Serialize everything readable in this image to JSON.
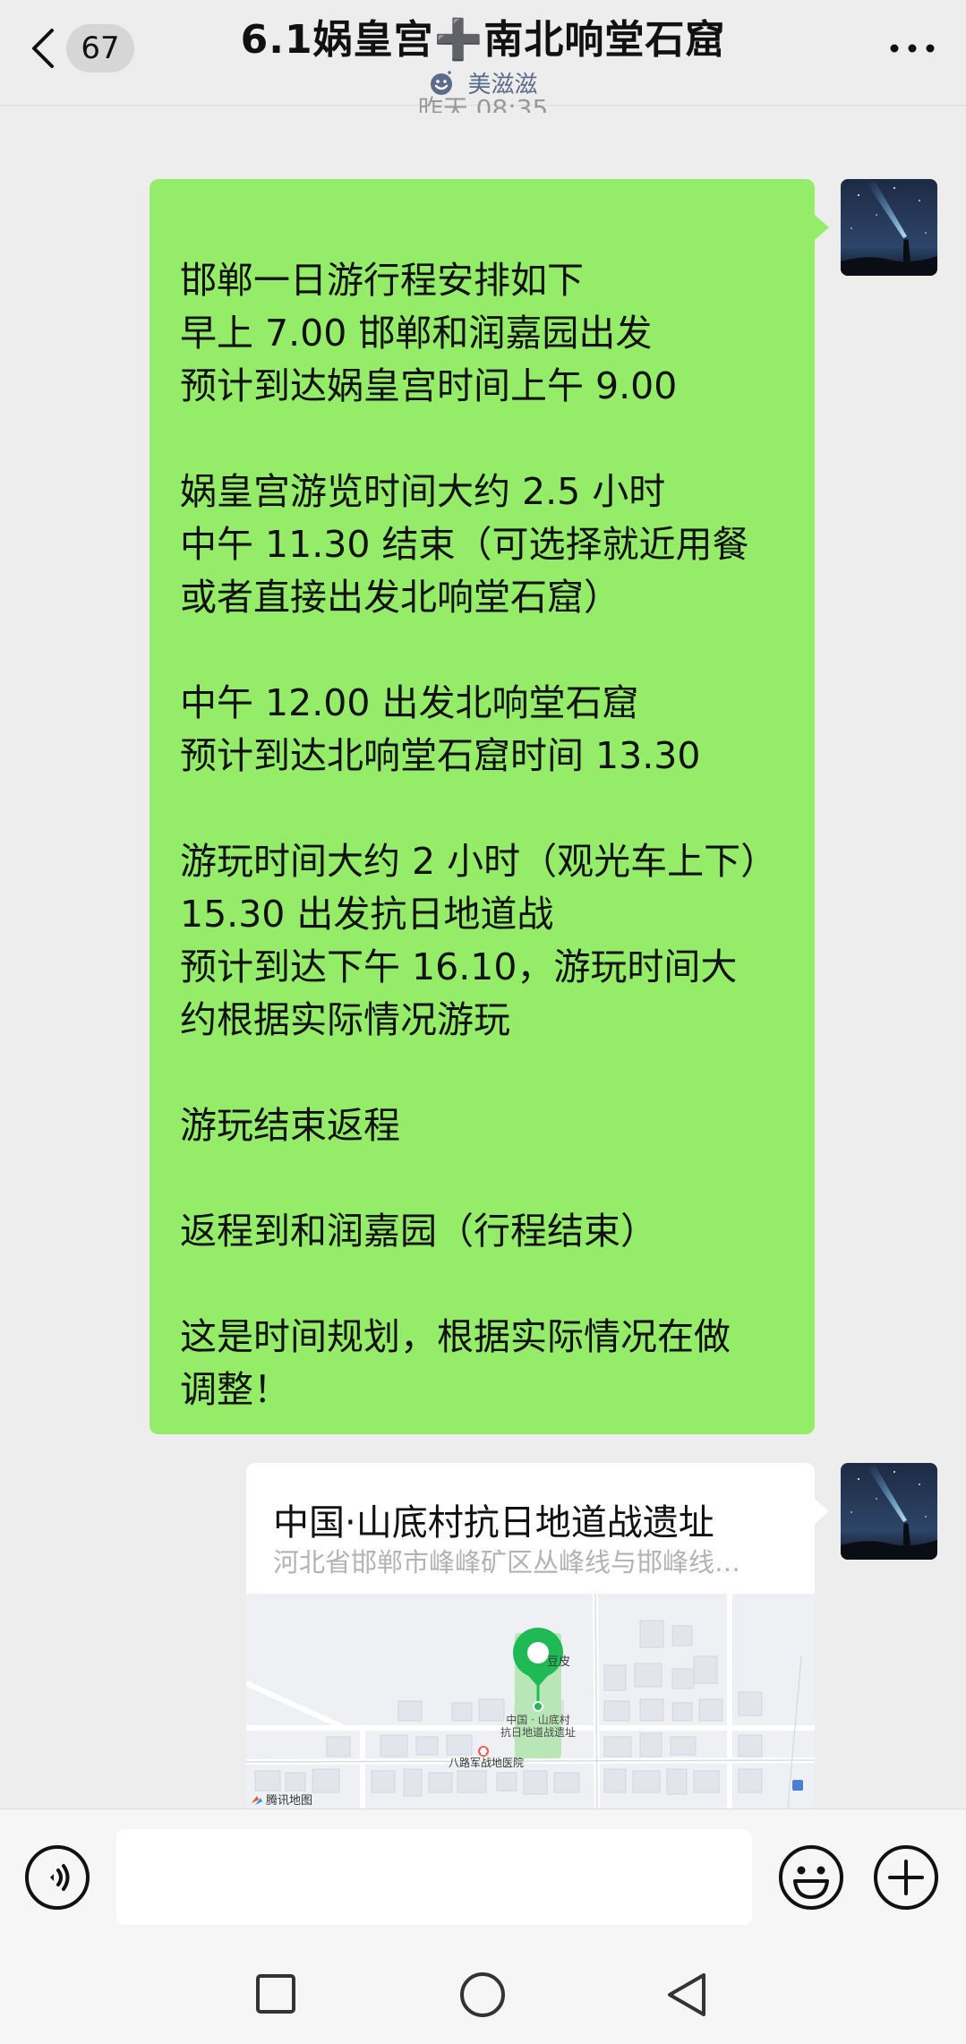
{
  "header": {
    "back_icon": "chevron-left-icon",
    "unread_count": "67",
    "title": "6.1娲皇宫➕南北响堂石窟",
    "subtitle": "美滋滋",
    "more_icon": "more-dots-icon"
  },
  "timestamp": "昨天 08:35",
  "messages": {
    "text_message": {
      "lines": [
        "邯郸一日游行程安排如下",
        "早上 7.00 邯郸和润嘉园出发",
        "预计到达娲皇宫时间上午 9.00",
        "",
        "娲皇宫游览时间大约 2.5 小时",
        "中午 11.30 结束（可选择就近用餐",
        "或者直接出发北响堂石窟）",
        "",
        "中午 12.00 出发北响堂石窟",
        "预计到达北响堂石窟时间 13.30",
        "",
        "游玩时间大约 2 小时（观光车上下）",
        "15.30 出发抗日地道战",
        "预计到达下午 16.10，游玩时间大",
        "约根据实际情况游玩",
        "",
        "游玩结束返程",
        "",
        "返程到和润嘉园（行程结束）",
        "",
        "这是时间规划，根据实际情况在做",
        "调整！"
      ]
    },
    "location_message": {
      "title": "中国·山底村抗日地道战遗址",
      "address": "河北省邯郸市峰峰矿区丛峰线与邯峰线…",
      "map": {
        "pin_label_line1": "中国 · 山底村",
        "pin_label_line2": "抗日地道战遗址",
        "poi_hospital": "八路军战地医院",
        "poi_top": "豆皮",
        "brand": "腾讯地图"
      }
    }
  },
  "input_bar": {
    "voice_icon": "voice-icon",
    "input_value": "",
    "emoji_icon": "emoji-icon",
    "plus_icon": "plus-icon"
  },
  "system_nav": {
    "recent_icon": "square-icon",
    "home_icon": "circle-icon",
    "back_icon": "triangle-back-icon"
  },
  "colors": {
    "background": "#ededed",
    "bubble_green": "#95ec69",
    "map_pin": "#1fb955",
    "subtitle_blue": "#5b6b8a"
  }
}
